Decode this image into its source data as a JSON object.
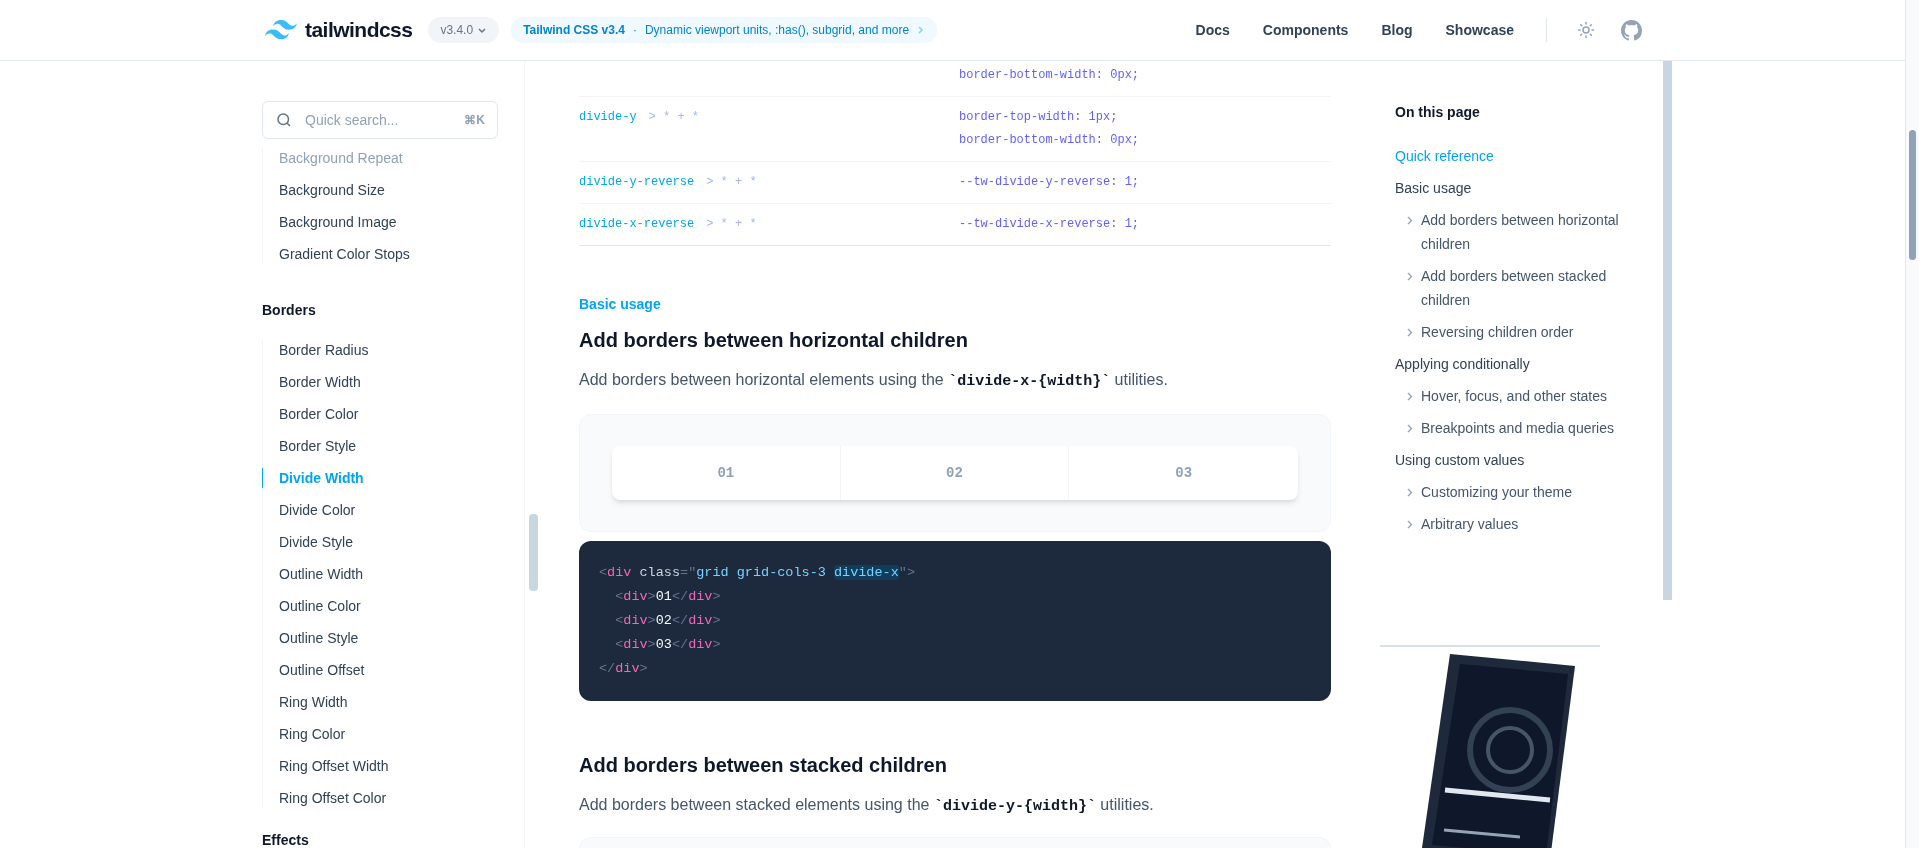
{
  "header": {
    "logo_text": "tailwindcss",
    "version": "v3.4.0",
    "announcement": {
      "title": "Tailwind CSS v3.4",
      "separator": "·",
      "text": "Dynamic viewport units, :has(), subgrid, and more"
    },
    "nav": [
      "Docs",
      "Components",
      "Blog",
      "Showcase"
    ]
  },
  "sidebar": {
    "search": {
      "placeholder": "Quick search...",
      "shortcut": "⌘K"
    },
    "groups": [
      {
        "items": [
          {
            "label": "Background Repeat",
            "selected": false
          },
          {
            "label": "Background Size",
            "selected": false
          },
          {
            "label": "Background Image",
            "selected": false
          },
          {
            "label": "Gradient Color Stops",
            "selected": false
          }
        ]
      },
      {
        "title": "Borders",
        "items": [
          {
            "label": "Border Radius",
            "selected": false
          },
          {
            "label": "Border Width",
            "selected": false
          },
          {
            "label": "Border Color",
            "selected": false
          },
          {
            "label": "Border Style",
            "selected": false
          },
          {
            "label": "Divide Width",
            "selected": true
          },
          {
            "label": "Divide Color",
            "selected": false
          },
          {
            "label": "Divide Style",
            "selected": false
          },
          {
            "label": "Outline Width",
            "selected": false
          },
          {
            "label": "Outline Color",
            "selected": false
          },
          {
            "label": "Outline Style",
            "selected": false
          },
          {
            "label": "Outline Offset",
            "selected": false
          },
          {
            "label": "Ring Width",
            "selected": false
          },
          {
            "label": "Ring Color",
            "selected": false
          },
          {
            "label": "Ring Offset Width",
            "selected": false
          },
          {
            "label": "Ring Offset Color",
            "selected": false
          }
        ]
      },
      {
        "title": "Effects"
      }
    ]
  },
  "reference_table": {
    "rows": [
      {
        "properties": [
          "border-bottom-width: 0px;"
        ]
      },
      {
        "class": "divide-y",
        "selector": "> * + *",
        "properties": [
          "border-top-width: 1px;",
          "border-bottom-width: 0px;"
        ]
      },
      {
        "class": "divide-y-reverse",
        "selector": "> * + *",
        "properties": [
          "--tw-divide-y-reverse: 1;"
        ]
      },
      {
        "class": "divide-x-reverse",
        "selector": "> * + *",
        "properties": [
          "--tw-divide-x-reverse: 1;"
        ]
      }
    ]
  },
  "sections": [
    {
      "eyebrow": "Basic usage",
      "heading": "Add borders between horizontal children",
      "description": {
        "before": "Add borders between horizontal elements using the ",
        "code": "`divide-x-{width}`",
        "after": " utilities."
      },
      "demo": {
        "cells": [
          "01",
          "02",
          "03"
        ]
      },
      "code": [
        [
          {
            "kind": "punct",
            "text": "<"
          },
          {
            "kind": "tag",
            "text": "div"
          },
          {
            "kind": "attr",
            "text": "class"
          },
          {
            "kind": "punct",
            "text": "=\""
          },
          {
            "kind": "string",
            "text": "grid grid-cols-3 "
          },
          {
            "kind": "highlight",
            "text": "divide-x"
          },
          {
            "kind": "punct",
            "text": "\">"
          }
        ],
        [
          {
            "kind": "indent"
          },
          {
            "kind": "punct",
            "text": "<"
          },
          {
            "kind": "tag",
            "text": "div"
          },
          {
            "kind": "punct",
            "text": ">"
          },
          {
            "kind": "text",
            "text": "01"
          },
          {
            "kind": "punct",
            "text": "</"
          },
          {
            "kind": "tag",
            "text": "div"
          },
          {
            "kind": "punct",
            "text": ">"
          }
        ],
        [
          {
            "kind": "indent"
          },
          {
            "kind": "punct",
            "text": "<"
          },
          {
            "kind": "tag",
            "text": "div"
          },
          {
            "kind": "punct",
            "text": ">"
          },
          {
            "kind": "text",
            "text": "02"
          },
          {
            "kind": "punct",
            "text": "</"
          },
          {
            "kind": "tag",
            "text": "div"
          },
          {
            "kind": "punct",
            "text": ">"
          }
        ],
        [
          {
            "kind": "indent"
          },
          {
            "kind": "punct",
            "text": "<"
          },
          {
            "kind": "tag",
            "text": "div"
          },
          {
            "kind": "punct",
            "text": ">"
          },
          {
            "kind": "text",
            "text": "03"
          },
          {
            "kind": "punct",
            "text": "</"
          },
          {
            "kind": "tag",
            "text": "div"
          },
          {
            "kind": "punct",
            "text": ">"
          }
        ],
        [
          {
            "kind": "punct",
            "text": "</"
          },
          {
            "kind": "tag",
            "text": "div"
          },
          {
            "kind": "punct",
            "text": ">"
          }
        ]
      ]
    },
    {
      "heading": "Add borders between stacked children",
      "description": {
        "before": "Add borders between stacked elements using the ",
        "code": "`divide-y-{width}`",
        "after": " utilities."
      }
    }
  ],
  "toc": {
    "title": "On this page",
    "items": [
      {
        "label": "Quick reference",
        "selected": true
      },
      {
        "label": "Basic usage",
        "selected": false,
        "children": [
          {
            "label": "Add borders between horizontal children",
            "selected": false
          },
          {
            "label": "Add borders between stacked children",
            "selected": false
          },
          {
            "label": "Reversing children order",
            "selected": false
          }
        ]
      },
      {
        "label": "Applying conditionally",
        "selected": false,
        "children": [
          {
            "label": "Hover, focus, and other states",
            "selected": false
          },
          {
            "label": "Breakpoints and media queries",
            "selected": false
          }
        ]
      },
      {
        "label": "Using custom values",
        "selected": false,
        "children": [
          {
            "label": "Customizing your theme",
            "selected": false
          },
          {
            "label": "Arbitrary values",
            "selected": false
          }
        ]
      }
    ]
  }
}
